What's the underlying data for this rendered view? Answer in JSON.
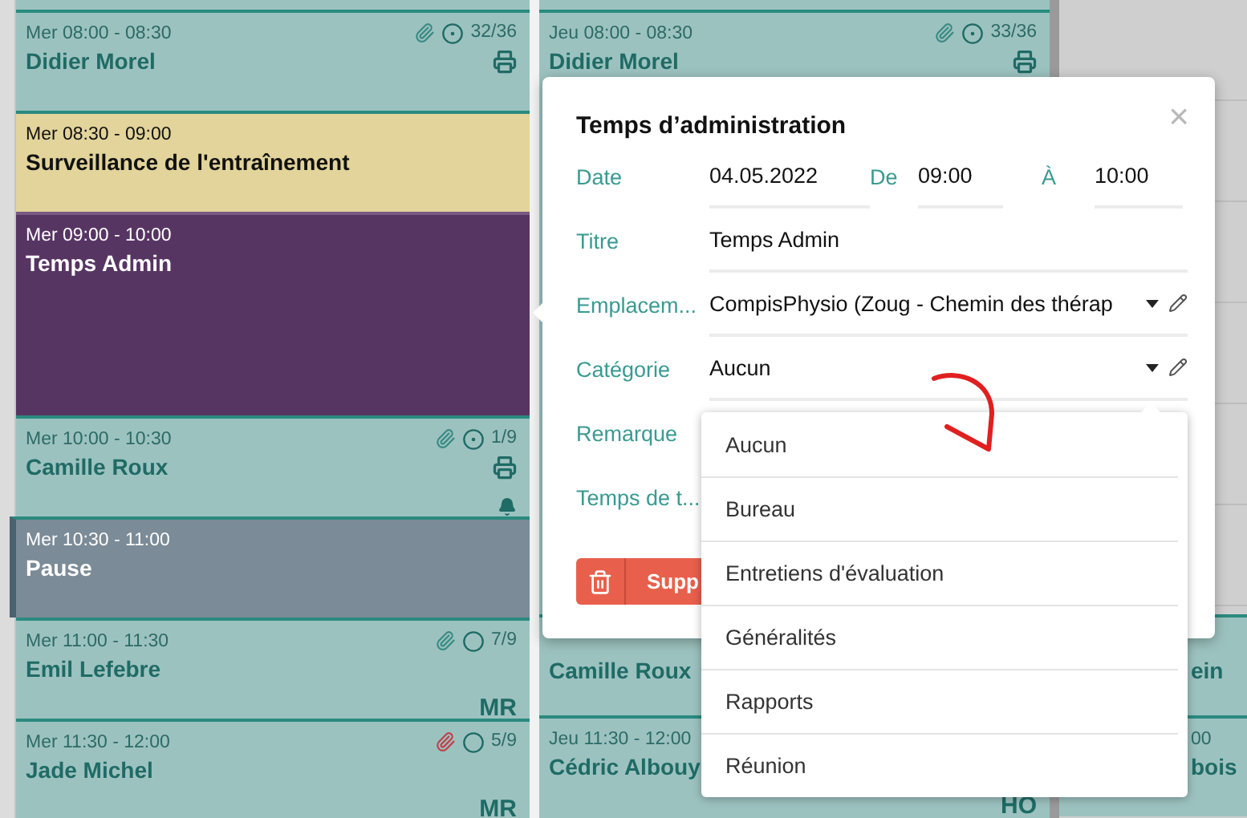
{
  "columns": [
    {
      "top": [
        {
          "kind": "patient",
          "time": "Mer 08:00 - 08:30",
          "name": "Didier Morel",
          "attachment": true,
          "attachment_alert": false,
          "confirmed": true,
          "count": "32/36",
          "print": true
        },
        {
          "kind": "task",
          "time": "Mer 08:30 - 09:00",
          "name": "Surveillance de l'entraînement"
        },
        {
          "kind": "admin",
          "time": "Mer 09:00 - 10:00",
          "name": "Temps Admin"
        },
        {
          "kind": "patient",
          "time": "Mer 10:00 - 10:30",
          "name": "Camille Roux",
          "attachment": true,
          "attachment_alert": false,
          "confirmed": true,
          "count": "1/9",
          "print": true,
          "reminder": true
        },
        {
          "kind": "break",
          "time": "Mer 10:30 - 11:00",
          "name": "Pause"
        },
        {
          "kind": "patient",
          "time": "Mer 11:00 - 11:30",
          "name": "Emil Lefebre",
          "attachment": true,
          "attachment_alert": false,
          "confirmed": false,
          "count": "7/9",
          "initials": "MR"
        },
        {
          "kind": "patient",
          "time": "Mer 11:30 - 12:00",
          "name": "Jade Michel",
          "attachment": true,
          "attachment_alert": true,
          "confirmed": false,
          "count": "5/9",
          "initials": "MR"
        }
      ]
    },
    {
      "top": [
        {
          "kind": "patient",
          "time": "Jeu 08:00 - 08:30",
          "name": "Didier Morel",
          "attachment": true,
          "attachment_alert": false,
          "confirmed": true,
          "count": "33/36",
          "print": true
        }
      ],
      "bottom": [
        {
          "kind": "patient",
          "name": "Camille Roux"
        },
        {
          "kind": "patient",
          "time": "Jeu 11:30 - 12:00",
          "name": "Cédric Albouy",
          "initials": "HO"
        }
      ]
    },
    {
      "bottom": [
        {
          "kind": "patient",
          "name": "ein"
        },
        {
          "kind": "patient",
          "time": "00",
          "name": "bois"
        }
      ]
    }
  ],
  "popover": {
    "title": "Temps d’administration",
    "close": "×",
    "date": {
      "label": "Date",
      "value": "04.05.2022",
      "from_label": "De",
      "from": "09:00",
      "to_label": "À",
      "to": "10:00"
    },
    "fields": [
      {
        "kind": "text",
        "label": "Titre",
        "value": "Temps Admin"
      },
      {
        "kind": "select",
        "label": "Emplacem...",
        "value": "CompisPhysio (Zoug - Chemin des thérap"
      },
      {
        "kind": "select",
        "label": "Catégorie",
        "value": "Aucun"
      },
      {
        "kind": "text",
        "label": "Remarque"
      },
      {
        "kind": "text",
        "label": "Temps de t..."
      }
    ],
    "delete_button": "Supp"
  },
  "dropdown": {
    "options": [
      "Aucun",
      "Bureau",
      "Entretiens d'évaluation",
      "Généralités",
      "Rapports",
      "Réunion"
    ]
  }
}
